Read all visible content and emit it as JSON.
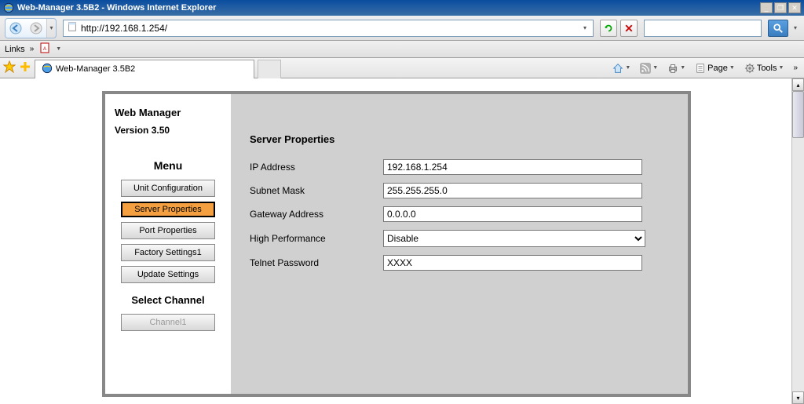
{
  "window": {
    "title": "Web-Manager 3.5B2 - Windows Internet Explorer"
  },
  "nav": {
    "url": "http://192.168.1.254/"
  },
  "links_bar": {
    "label": "Links"
  },
  "tab": {
    "title": "Web-Manager 3.5B2"
  },
  "toolbar": {
    "page_label": "Page",
    "tools_label": "Tools"
  },
  "sidebar": {
    "title": "Web Manager",
    "version": "Version 3.50",
    "menu_header": "Menu",
    "items": [
      {
        "label": "Unit Configuration",
        "active": false
      },
      {
        "label": "Server Properties",
        "active": true
      },
      {
        "label": "Port Properties",
        "active": false
      },
      {
        "label": "Factory Settings1",
        "active": false
      },
      {
        "label": "Update Settings",
        "active": false
      }
    ],
    "select_header": "Select Channel",
    "channel_btn": "Channel1"
  },
  "main": {
    "section_title": "Server Properties",
    "fields": {
      "ip_label": "IP Address",
      "ip_value": "192.168.1.254",
      "subnet_label": "Subnet Mask",
      "subnet_value": "255.255.255.0",
      "gateway_label": "Gateway Address",
      "gateway_value": "0.0.0.0",
      "perf_label": "High Performance",
      "perf_value": "Disable",
      "telnet_label": "Telnet Password",
      "telnet_value": "XXXX"
    }
  }
}
